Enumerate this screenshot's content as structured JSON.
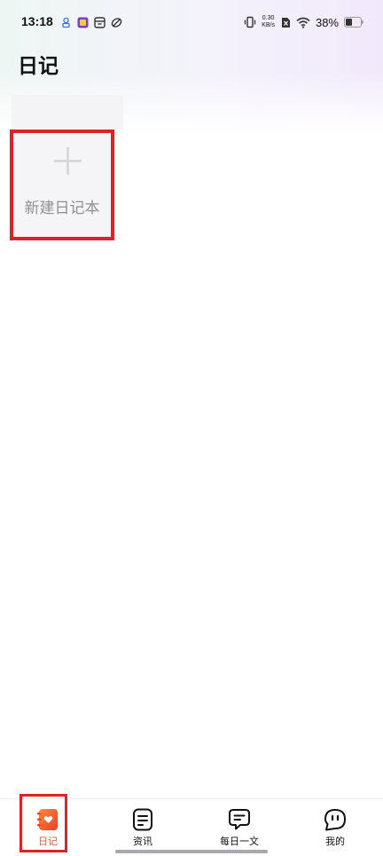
{
  "status_bar": {
    "time": "13:18",
    "net_speed_value": "0.30",
    "net_speed_unit": "KB/s",
    "battery_percent": "38%"
  },
  "header": {
    "title": "日记"
  },
  "notebooks": {
    "new_notebook_label": "新建日记本"
  },
  "bottom_nav": {
    "items": [
      {
        "label": "日记",
        "icon": "diary-icon",
        "active": true
      },
      {
        "label": "资讯",
        "icon": "news-icon",
        "active": false
      },
      {
        "label": "每日一文",
        "icon": "chat-icon",
        "active": false
      },
      {
        "label": "我的",
        "icon": "profile-face-icon",
        "active": false
      }
    ]
  },
  "colors": {
    "accent": "#f0542b",
    "highlight_box": "#e02128",
    "card_background": "#f5f5f8",
    "muted_text": "#8e8e93"
  }
}
